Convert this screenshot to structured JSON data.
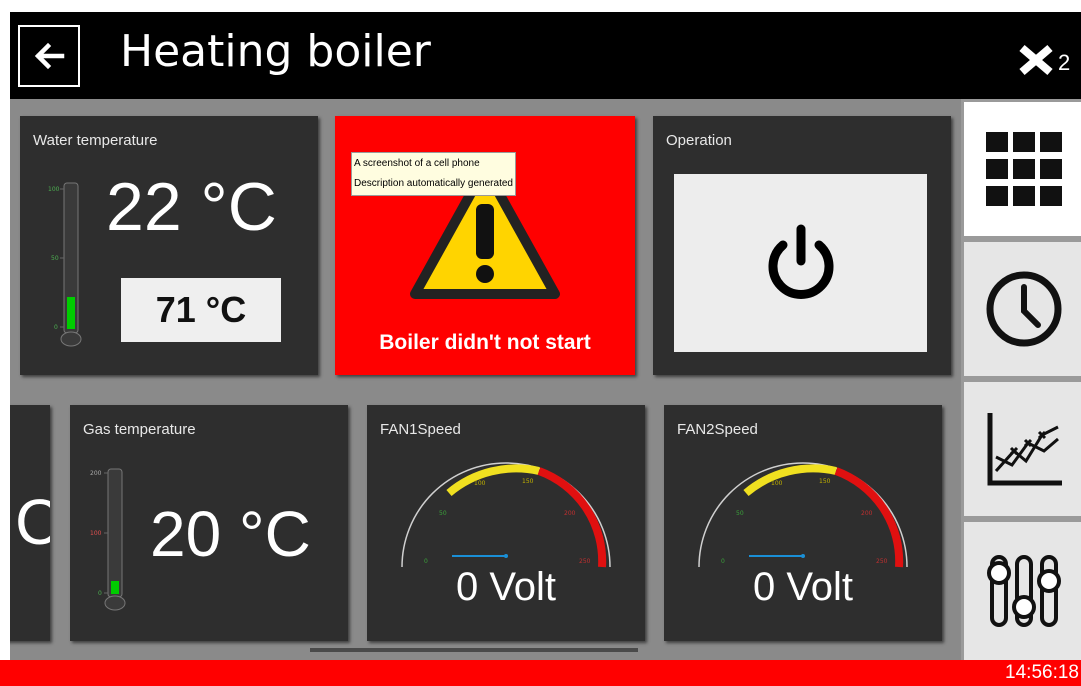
{
  "header": {
    "title": "Heating boiler",
    "logo_superscript": "2"
  },
  "tiles": {
    "water": {
      "label": "Water temperature",
      "value": "22 °C",
      "setpoint": "71 °C",
      "thermometer_ticks": [
        "100",
        "50",
        "0"
      ],
      "level_percent": 22
    },
    "alarm": {
      "message": "Boiler didn't not start",
      "tooltip_line1": "A screenshot of a cell phone",
      "tooltip_line2": "Description automatically generated"
    },
    "operation": {
      "label": "Operation"
    },
    "gas": {
      "label": "Gas temperature",
      "value": "20 °C",
      "thermometer_ticks": [
        "200",
        "100",
        "0"
      ],
      "level_percent": 10
    },
    "partial_value": "C",
    "fan1": {
      "label": "FAN1Speed",
      "value": "0 Volt",
      "gauge_ticks": [
        "0",
        "50",
        "100",
        "150",
        "200",
        "250"
      ]
    },
    "fan2": {
      "label": "FAN2Speed",
      "value": "0 Volt",
      "gauge_ticks": [
        "0",
        "50",
        "100",
        "150",
        "200",
        "250"
      ]
    }
  },
  "sidebar": {
    "items": [
      {
        "icon": "grid-icon",
        "active": true
      },
      {
        "icon": "clock-icon",
        "active": false
      },
      {
        "icon": "chart-icon",
        "active": false
      },
      {
        "icon": "sliders-icon",
        "active": false
      }
    ]
  },
  "footer": {
    "time": "14:56:18"
  },
  "colors": {
    "alarm_red": "#ff0000",
    "thermo_green": "#00cc00",
    "gauge_yellow": "#f0e020",
    "gauge_red": "#e01010",
    "needle_blue": "#1a8fd6"
  }
}
